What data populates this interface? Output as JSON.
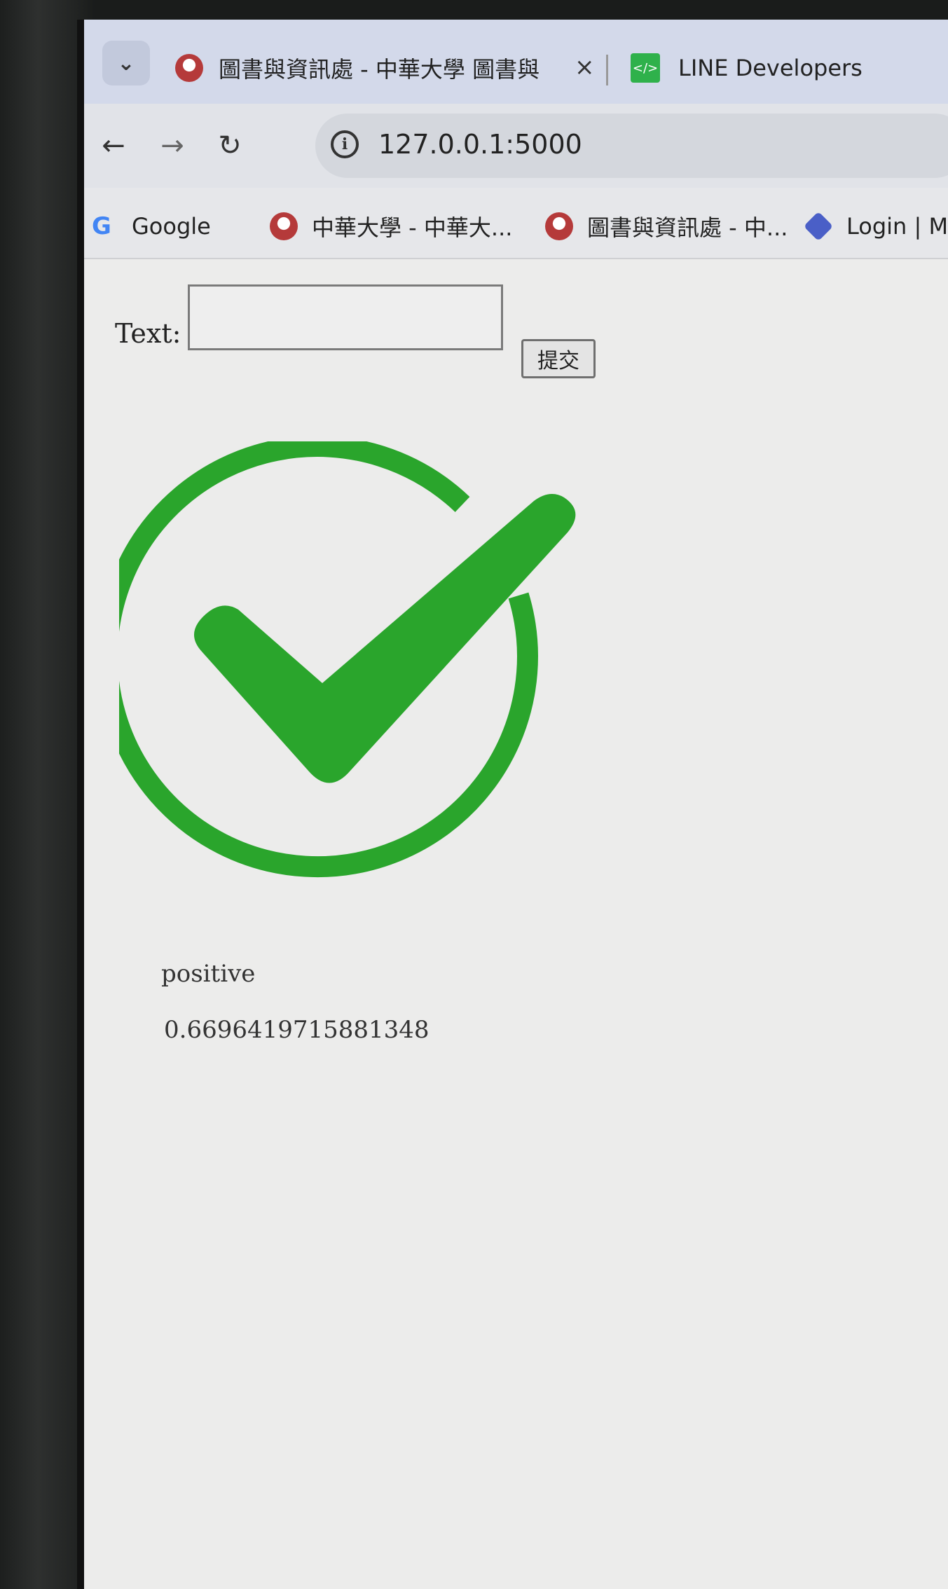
{
  "browser": {
    "tabs": [
      {
        "title": "圖書與資訊處 - 中華大學 圖書與",
        "active": true
      },
      {
        "title": "LINE Developers",
        "active": false
      }
    ],
    "tab_close_glyph": "×",
    "url": "127.0.0.1:5000",
    "bookmarks": [
      {
        "label": "Google",
        "icon": "google-icon"
      },
      {
        "label": "中華大學 - 中華大...",
        "icon": "chu-favicon"
      },
      {
        "label": "圖書與資訊處 - 中...",
        "icon": "chu-favicon"
      },
      {
        "label": "Login | M",
        "icon": "blue-diamond-icon"
      }
    ]
  },
  "form": {
    "text_label": "Text:",
    "textarea_value": "",
    "submit_label": "提交"
  },
  "result": {
    "label": "positive",
    "score": "0.6696419715881348",
    "icon": "green-checkmark",
    "accent_color": "#2aa52c"
  }
}
